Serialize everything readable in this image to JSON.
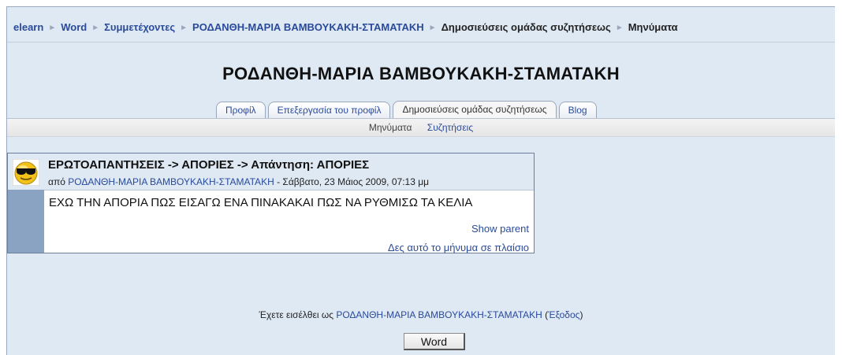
{
  "breadcrumb": {
    "items": [
      {
        "label": "elearn"
      },
      {
        "label": "Word"
      },
      {
        "label": "Συμμετέχοντες"
      },
      {
        "label": "ΡΟΔΑΝΘΗ-ΜΑΡΙΑ ΒΑΜΒΟΥΚΑΚΗ-ΣΤΑΜΑΤΑΚΗ"
      },
      {
        "label": "Δημοσιεύσεις ομάδας συζητήσεως"
      }
    ],
    "current": "Μηνύματα",
    "separator": "►"
  },
  "page_title": "ΡΟΔΑΝΘΗ-ΜΑΡΙΑ ΒΑΜΒΟΥΚΑΚΗ-ΣΤΑΜΑΤΑΚΗ",
  "tabs": [
    {
      "label": "Προφίλ",
      "active": false
    },
    {
      "label": "Επεξεργασία του προφίλ",
      "active": false
    },
    {
      "label": "Δημοσιεύσεις ομάδας συζητήσεως",
      "active": true
    },
    {
      "label": "Blog",
      "active": false
    }
  ],
  "subtabs": [
    {
      "label": "Μηνύματα",
      "active": true
    },
    {
      "label": "Συζητήσεις",
      "active": false
    }
  ],
  "post": {
    "subject": "ΕΡΩΤΟΑΠΑΝΤΗΣΕΙΣ -> ΑΠΟΡΙΕΣ -> Απάντηση: ΑΠΟΡΙΕΣ",
    "by_prefix": "από",
    "author": "ΡΟΔΑΝΘΗ-ΜΑΡΙΑ ΒΑΜΒΟΥΚΑΚΗ-ΣΤΑΜΑΤΑΚΗ",
    "date": "Σάββατο, 23 Μάιος 2009, 07:13 μμ",
    "body": "ΕΧΩ ΤΗΝ ΑΠΟΡΙΑ ΠΩΣ ΕΙΣΑΓΩ ΕΝΑ ΠΙΝΑΚΑΚΑΙ ΠΩΣ ΝΑ ΡΥΘΜΙΣΩ ΤΑ ΚΕΛΙΑ",
    "show_parent": "Show parent",
    "view_in_frame": "Δες αυτό το μήνυμα σε πλαίσιο",
    "avatar_icon": "sunglasses-smiley-icon"
  },
  "footer": {
    "logged_in_prefix": "Έχετε εισέλθει ως",
    "user": "ΡΟΔΑΝΘΗ-ΜΑΡΙΑ ΒΑΜΒΟΥΚΑΚΗ-ΣΤΑΜΑΤΑΚΗ",
    "logout": "Έξοδος",
    "course_button": "Word"
  },
  "colors": {
    "page_bg": "#dfe9f3",
    "link": "#2a4a9a",
    "post_side": "#8aa3c3"
  }
}
